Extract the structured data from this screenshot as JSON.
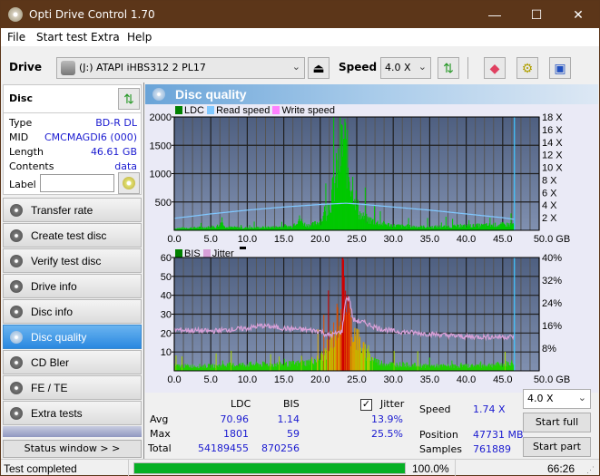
{
  "window": {
    "title": "Opti Drive Control 1.70",
    "controls": {
      "minimize": "—",
      "maximize": "☐",
      "close": "✕"
    }
  },
  "menu": [
    "File",
    "Start test",
    "Extra",
    "Help"
  ],
  "toolbar": {
    "drive_label": "Drive",
    "drive_value": "(J:)  ATAPI iHBS312   2 PL17",
    "speed_label": "Speed",
    "speed_value": "4.0 X",
    "icons": [
      "eject-icon",
      "refresh-icon",
      "erase-icon",
      "settings-icon",
      "save-icon"
    ]
  },
  "disc": {
    "header": "Disc",
    "fields": [
      {
        "label": "Type",
        "value": "BD-R DL"
      },
      {
        "label": "MID",
        "value": "CMCMAGDI6 (000)"
      },
      {
        "label": "Length",
        "value": "46.61 GB"
      },
      {
        "label": "Contents",
        "value": "data"
      }
    ],
    "label_field": {
      "label": "Label",
      "value": ""
    }
  },
  "nav": [
    {
      "label": "Transfer rate",
      "active": false
    },
    {
      "label": "Create test disc",
      "active": false
    },
    {
      "label": "Verify test disc",
      "active": false
    },
    {
      "label": "Drive info",
      "active": false
    },
    {
      "label": "Disc info",
      "active": false
    },
    {
      "label": "Disc quality",
      "active": true
    },
    {
      "label": "CD Bler",
      "active": false
    },
    {
      "label": "FE / TE",
      "active": false
    },
    {
      "label": "Extra tests",
      "active": false
    }
  ],
  "status_window_button": "Status window > >",
  "main": {
    "title": "Disc quality"
  },
  "colors": {
    "ldc": "#00c800",
    "read_speed": "#80c8ff",
    "write_speed": "#ff80ff",
    "bis": "#00c800",
    "jitter": "#d8a0d8",
    "plot_bg_top": "#4e5f80",
    "plot_bg_bottom": "#8090b0",
    "progress": "#06b025"
  },
  "chart_data": [
    {
      "type": "bar",
      "title": "LDC / Read speed",
      "legend": [
        "LDC",
        "Read speed",
        "Write speed"
      ],
      "legend_position": "top-left",
      "xlabel": "GB",
      "x_ticks": [
        "0.0",
        "5.0",
        "10.0",
        "15.0",
        "20.0",
        "25.0",
        "30.0",
        "35.0",
        "40.0",
        "45.0",
        "50.0 GB"
      ],
      "xlim": [
        0,
        50
      ],
      "ylim": [
        0,
        2000
      ],
      "y_ticks": [
        "500",
        "1000",
        "1500",
        "2000"
      ],
      "y2lim": [
        0,
        18
      ],
      "y2_ticks": [
        "2 X",
        "4 X",
        "6 X",
        "8 X",
        "10 X",
        "12 X",
        "14 X",
        "16 X",
        "18 X"
      ],
      "grid": true,
      "end_marker_gb": 46.61,
      "ldc_profile": [
        [
          0,
          40
        ],
        [
          2,
          50
        ],
        [
          4,
          60
        ],
        [
          6,
          70
        ],
        [
          6.5,
          230
        ],
        [
          7,
          60
        ],
        [
          8,
          60
        ],
        [
          10,
          50
        ],
        [
          12,
          60
        ],
        [
          14,
          70
        ],
        [
          16,
          80
        ],
        [
          17,
          240
        ],
        [
          18,
          100
        ],
        [
          19,
          120
        ],
        [
          20,
          200
        ],
        [
          21,
          400
        ],
        [
          21.5,
          700
        ],
        [
          22,
          1000
        ],
        [
          22.5,
          1400
        ],
        [
          23,
          1790
        ],
        [
          23.3,
          1800
        ],
        [
          23.6,
          1500
        ],
        [
          24,
          1100
        ],
        [
          24.5,
          900
        ],
        [
          25,
          500
        ],
        [
          25.5,
          300
        ],
        [
          26,
          250
        ],
        [
          27,
          200
        ],
        [
          28,
          150
        ],
        [
          30,
          100
        ],
        [
          32,
          80
        ],
        [
          35,
          70
        ],
        [
          38,
          80
        ],
        [
          40,
          90
        ],
        [
          42,
          100
        ],
        [
          44,
          110
        ],
        [
          46,
          120
        ],
        [
          46.6,
          130
        ]
      ],
      "read_speed": [
        [
          0,
          1.9
        ],
        [
          5,
          2.6
        ],
        [
          10,
          3.2
        ],
        [
          15,
          3.7
        ],
        [
          20,
          4.1
        ],
        [
          23.5,
          4.3
        ],
        [
          25,
          4.2
        ],
        [
          30,
          3.7
        ],
        [
          35,
          3.2
        ],
        [
          40,
          2.6
        ],
        [
          45,
          2.0
        ],
        [
          46.6,
          1.74
        ]
      ]
    },
    {
      "type": "bar",
      "title": "BIS / Jitter",
      "legend": [
        "BIS",
        "Jitter"
      ],
      "legend_position": "top-left",
      "xlabel": "GB",
      "x_ticks": [
        "0.0",
        "5.0",
        "10.0",
        "15.0",
        "20.0",
        "25.0",
        "30.0",
        "35.0",
        "40.0",
        "45.0",
        "50.0 GB"
      ],
      "xlim": [
        0,
        50
      ],
      "ylim": [
        0,
        60
      ],
      "y_ticks": [
        "10",
        "20",
        "30",
        "40",
        "50",
        "60"
      ],
      "y2lim": [
        0,
        40
      ],
      "y2_ticks": [
        "8%",
        "16%",
        "24%",
        "32%",
        "40%"
      ],
      "grid": true,
      "end_marker_gb": 46.61,
      "bis_profile": [
        [
          0,
          3
        ],
        [
          5,
          3
        ],
        [
          10,
          4
        ],
        [
          15,
          4
        ],
        [
          18,
          5
        ],
        [
          20,
          8
        ],
        [
          21,
          14
        ],
        [
          22,
          25
        ],
        [
          22.5,
          35
        ],
        [
          23,
          50
        ],
        [
          23.2,
          59
        ],
        [
          23.5,
          45
        ],
        [
          24,
          30
        ],
        [
          24.5,
          25
        ],
        [
          25,
          20
        ],
        [
          26,
          12
        ],
        [
          27,
          8
        ],
        [
          28,
          5
        ],
        [
          30,
          4
        ],
        [
          35,
          3
        ],
        [
          40,
          3
        ],
        [
          45,
          4
        ],
        [
          46.6,
          5
        ]
      ],
      "jitter_profile": [
        [
          0,
          14.5
        ],
        [
          5,
          14
        ],
        [
          10,
          15
        ],
        [
          12,
          16
        ],
        [
          15,
          15
        ],
        [
          18,
          14.5
        ],
        [
          20,
          14
        ],
        [
          21,
          12.5
        ],
        [
          22,
          13
        ],
        [
          23,
          14
        ],
        [
          23.5,
          25.5
        ],
        [
          24,
          25.5
        ],
        [
          24.5,
          18
        ],
        [
          26,
          17
        ],
        [
          28,
          15
        ],
        [
          30,
          14
        ],
        [
          35,
          13
        ],
        [
          40,
          12
        ],
        [
          45,
          12
        ],
        [
          46.6,
          12
        ]
      ]
    }
  ],
  "stats": {
    "columns": [
      "LDC",
      "BIS"
    ],
    "rows": [
      {
        "label": "Avg",
        "ldc": "70.96",
        "bis": "1.14",
        "jitter": "13.9%"
      },
      {
        "label": "Max",
        "ldc": "1801",
        "bis": "59",
        "jitter": "25.5%"
      },
      {
        "label": "Total",
        "ldc": "54189455",
        "bis": "870256",
        "jitter": ""
      }
    ],
    "jitter_label": "Jitter",
    "jitter_checked": true,
    "speed_label": "Speed",
    "speed_value": "1.74 X",
    "position_label": "Position",
    "position_value": "47731 MB",
    "samples_label": "Samples",
    "samples_value": "761889",
    "speed_select": "4.0 X",
    "start_full": "Start full",
    "start_part": "Start part"
  },
  "statusbar": {
    "text": "Test completed",
    "progress_percent": 100.0,
    "progress_label": "100.0%",
    "time": "66:26"
  }
}
